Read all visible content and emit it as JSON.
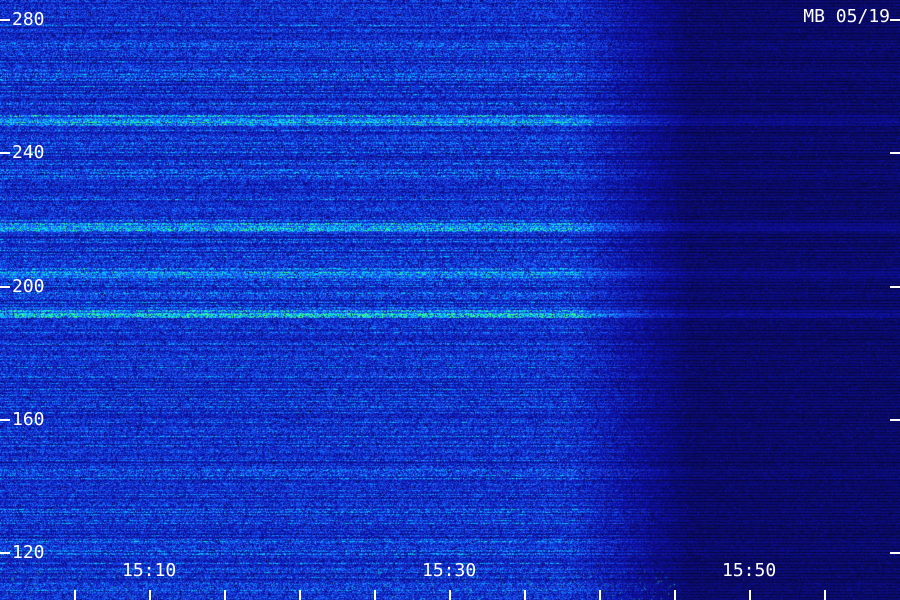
{
  "header": {
    "station_label": "MB 05/19"
  },
  "chart_data": {
    "type": "heatmap",
    "title": "",
    "xlabel": "",
    "ylabel": "",
    "x_ticks": [
      "15:10",
      "15:30",
      "15:50"
    ],
    "x_tick_minutes": [
      10,
      30,
      50
    ],
    "xlim_minutes": [
      0,
      60
    ],
    "y_ticks": [
      120,
      160,
      200,
      240,
      280
    ],
    "ylim": [
      106,
      286
    ],
    "grid": false,
    "legend": "none",
    "colors": {
      "background": "#06063a",
      "low": "#0a0a60",
      "mid": "#1a3cff",
      "high": "#00e0ff",
      "peak": "#40ff80",
      "text": "#ffffff",
      "tick": "#ffffff"
    },
    "bright_bands_frequency": [
      204,
      192,
      218,
      250
    ],
    "fade_start_minute": 38,
    "fade_end_minute": 46
  }
}
